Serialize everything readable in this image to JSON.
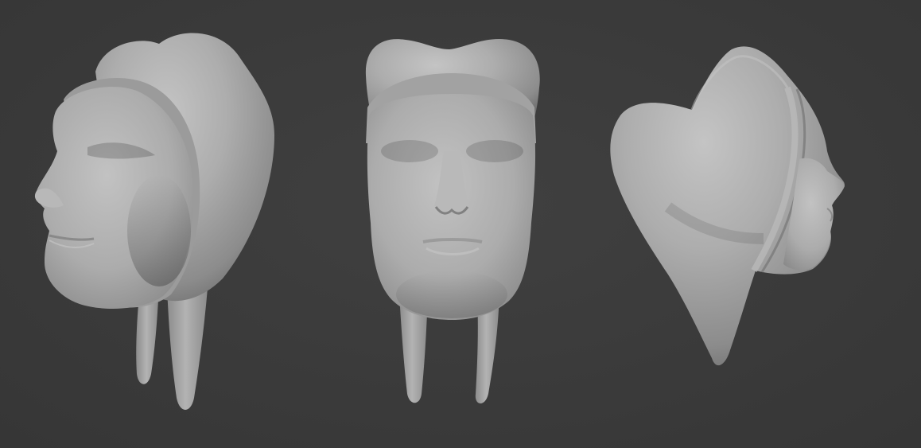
{
  "scene": {
    "background_color": "#3b3b3b",
    "material_color": "#a9a9a9",
    "views": [
      {
        "name": "three-quarter-left"
      },
      {
        "name": "front"
      },
      {
        "name": "right-side"
      }
    ]
  }
}
